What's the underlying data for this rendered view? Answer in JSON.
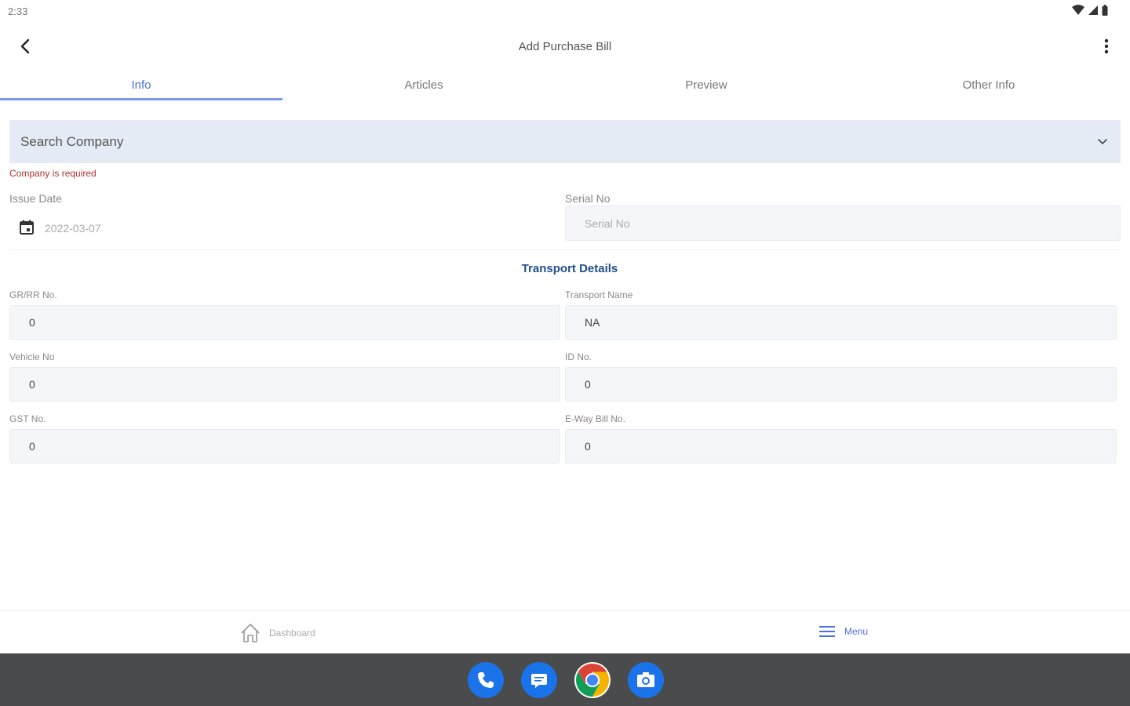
{
  "status_bar": {
    "time": "2:33"
  },
  "app_bar": {
    "title": "Add Purchase Bill"
  },
  "tabs": [
    {
      "label": "Info",
      "active": true
    },
    {
      "label": "Articles",
      "active": false
    },
    {
      "label": "Preview",
      "active": false
    },
    {
      "label": "Other Info",
      "active": false
    }
  ],
  "company": {
    "placeholder": "Search Company",
    "error": "Company is required"
  },
  "issue_date": {
    "label": "Issue Date",
    "value": "2022-03-07"
  },
  "serial_no": {
    "label": "Serial No",
    "placeholder": "Serial No",
    "value": ""
  },
  "transport": {
    "title": "Transport Details",
    "gr_rr": {
      "label": "GR/RR No.",
      "value": "0"
    },
    "transport_name": {
      "label": "Transport Name",
      "value": "NA"
    },
    "vehicle_no": {
      "label": "Vehicle No",
      "value": "0"
    },
    "id_no": {
      "label": "ID No.",
      "value": "0"
    },
    "gst_no": {
      "label": "GST No.",
      "value": "0"
    },
    "eway_bill": {
      "label": "E-Way Bill No.",
      "value": "0"
    }
  },
  "bottom_nav": {
    "dashboard": "Dashboard",
    "menu": "Menu"
  },
  "colors": {
    "accent": "#4b72e0",
    "error": "#b03030",
    "section_title": "#1f4e8c",
    "field_bg": "#f4f6fa",
    "select_bg": "#e5ebf4"
  },
  "icons": {
    "status": [
      "wifi-icon",
      "signal-icon",
      "battery-icon"
    ],
    "dock": [
      "phone-icon",
      "messages-icon",
      "chrome-icon",
      "camera-icon"
    ]
  }
}
